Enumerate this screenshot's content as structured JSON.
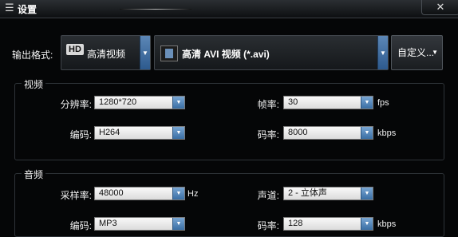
{
  "window": {
    "title": "设置",
    "menu_glyph": "☰",
    "close_glyph": "✕"
  },
  "format": {
    "label": "输出格式:",
    "category_badge": "HD",
    "category": "高清视频",
    "value": "高清 AVI 视频 (*.avi)",
    "custom_button": "自定义..."
  },
  "video": {
    "title": "视频",
    "resolution_label": "分辨率:",
    "resolution": "1280*720",
    "framerate_label": "帧率:",
    "framerate": "30",
    "framerate_unit": "fps",
    "codec_label": "编码:",
    "codec": "H264",
    "bitrate_label": "码率:",
    "bitrate": "8000",
    "bitrate_unit": "kbps"
  },
  "audio": {
    "title": "音频",
    "samplerate_label": "采样率:",
    "samplerate": "48000",
    "samplerate_unit": "Hz",
    "channel_label": "声道:",
    "channel": "2 - 立体声",
    "codec_label": "编码:",
    "codec": "MP3",
    "bitrate_label": "码率:",
    "bitrate": "128",
    "bitrate_unit": "kbps"
  }
}
